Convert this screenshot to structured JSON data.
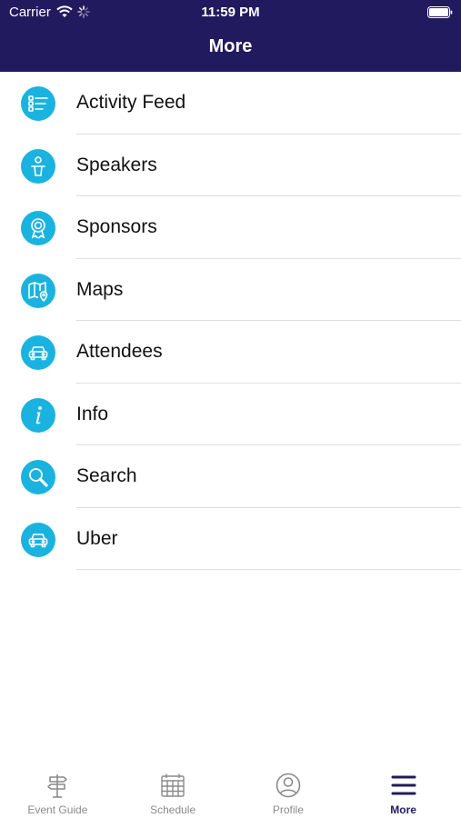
{
  "status_bar": {
    "carrier": "Carrier",
    "time": "11:59 PM"
  },
  "nav": {
    "title": "More"
  },
  "menu": [
    {
      "label": "Activity Feed",
      "icon": "activity-feed-icon"
    },
    {
      "label": "Speakers",
      "icon": "speaker-icon"
    },
    {
      "label": "Sponsors",
      "icon": "ribbon-badge-icon"
    },
    {
      "label": "Maps",
      "icon": "map-pin-icon"
    },
    {
      "label": "Attendees",
      "icon": "car-icon"
    },
    {
      "label": "Info",
      "icon": "info-icon"
    },
    {
      "label": "Search",
      "icon": "search-icon"
    },
    {
      "label": "Uber",
      "icon": "car-icon"
    }
  ],
  "tabs": [
    {
      "label": "Event Guide",
      "icon": "signpost-icon",
      "active": false
    },
    {
      "label": "Schedule",
      "icon": "calendar-icon",
      "active": false
    },
    {
      "label": "Profile",
      "icon": "user-icon",
      "active": false
    },
    {
      "label": "More",
      "icon": "hamburger-menu-icon",
      "active": true
    }
  ],
  "colors": {
    "header_bg": "#221a5e",
    "icon_bg": "#1ab3e0",
    "tab_active": "#221a5e",
    "tab_inactive": "#8a8a8a"
  }
}
